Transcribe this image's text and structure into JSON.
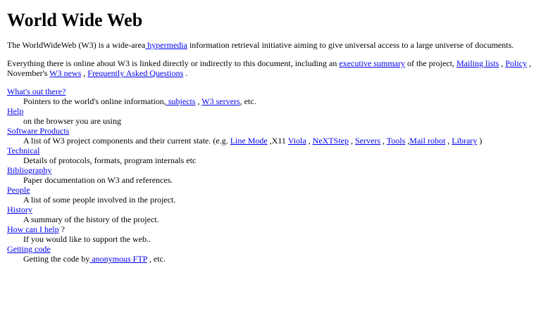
{
  "heading": "World Wide Web",
  "intro": {
    "text_1": "The WorldWideWeb (W3) is a wide-area",
    "link_hypermedia": " hypermedia",
    "text_2": " information retrieval initiative aiming to give universal access to a large universe of documents."
  },
  "summary": {
    "text_1": "Everything there is online about W3 is linked directly or indirectly to this document, including an ",
    "link_executive_summary": "executive summary",
    "text_2": " of the project, ",
    "link_mailing_lists": "Mailing lists",
    "sep_1": " , ",
    "link_policy": "Policy",
    "text_3": " , November's ",
    "link_w3_news": "W3 news",
    "sep_2": " , ",
    "link_faq": "Frequently Asked Questions",
    "text_4": " ."
  },
  "sections": {
    "whats_out_there": {
      "title": "What's out there?",
      "desc_1": "Pointers to the world's online information,",
      "link_subjects": " subjects",
      "sep_1": " , ",
      "link_w3_servers": "W3 servers",
      "desc_2": ", etc."
    },
    "help": {
      "title": "Help",
      "desc": "on the browser you are using"
    },
    "software_products": {
      "title": "Software Products",
      "desc_1": "A list of W3 project components and their current state. (e.g. ",
      "link_line_mode": "Line Mode",
      "text_x11": " ,X11 ",
      "link_viola": "Viola",
      "sep_1": " , ",
      "link_nextstep": "NeXTStep",
      "sep_2": " , ",
      "link_servers": "Servers",
      "sep_3": " , ",
      "link_tools": "Tools",
      "sep_4": " ,",
      "link_mail_robot": "Mail robot",
      "sep_5": " , ",
      "link_library": "Library",
      "desc_2": " )"
    },
    "technical": {
      "title": "Technical",
      "desc": "Details of protocols, formats, program internals etc"
    },
    "bibliography": {
      "title": "Bibliography",
      "desc": "Paper documentation on W3 and references."
    },
    "people": {
      "title": "People",
      "desc": "A list of some people involved in the project."
    },
    "history": {
      "title": "History",
      "desc": "A summary of the history of the project."
    },
    "how_can_i_help": {
      "title": "How can I help",
      "title_suffix": " ?",
      "desc": "If you would like to support the web.."
    },
    "getting_code": {
      "title": "Getting code",
      "desc_1": "Getting the code by",
      "link_anonymous_ftp": " anonymous FTP",
      "desc_2": " , etc."
    }
  }
}
